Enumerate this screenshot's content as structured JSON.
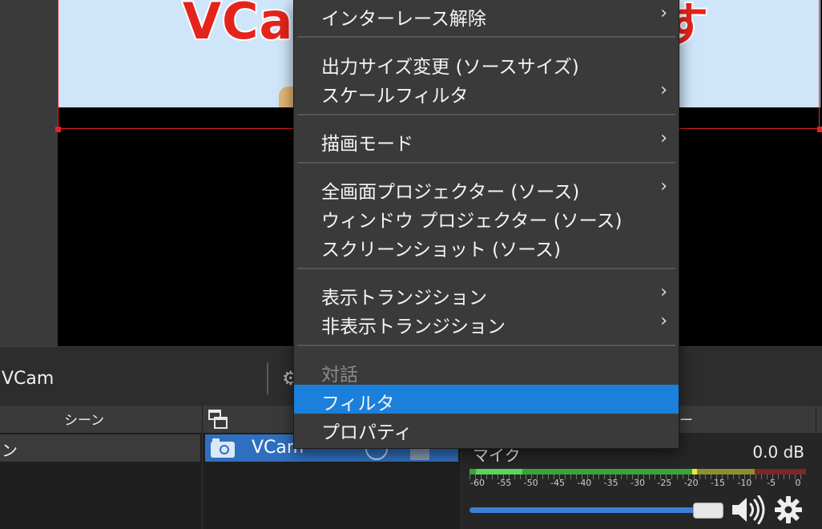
{
  "preview": {
    "banner_text_left": "VCa",
    "banner_text_right": "す"
  },
  "toolbar": {
    "source_name": "VCam"
  },
  "scenes": {
    "header": "シーン",
    "items": [
      {
        "label": "ン"
      }
    ]
  },
  "sources": {
    "items": [
      {
        "label": "VCam",
        "selected": true
      }
    ]
  },
  "mixer": {
    "header": "ー",
    "track_name": "マイク",
    "level": "0.0 dB",
    "meter_ticks": [
      "-60",
      "-55",
      "-50",
      "-45",
      "-40",
      "-35",
      "-30",
      "-25",
      "-20",
      "-15",
      "-10",
      "-5",
      "0"
    ],
    "volume_fraction": 1.0
  },
  "context_menu": {
    "items": [
      {
        "label": "インターレース解除",
        "submenu": true
      },
      {
        "label": "出力サイズ変更 (ソースサイズ)",
        "submenu": false
      },
      {
        "label": "スケールフィルタ",
        "submenu": true
      },
      {
        "label": "描画モード",
        "submenu": true
      },
      {
        "label": "全画面プロジェクター (ソース)",
        "submenu": true
      },
      {
        "label": "ウィンドウ プロジェクター (ソース)",
        "submenu": false
      },
      {
        "label": "スクリーンショット (ソース)",
        "submenu": false
      },
      {
        "label": "表示トランジション",
        "submenu": true
      },
      {
        "label": "非表示トランジション",
        "submenu": true
      },
      {
        "label": "対話",
        "submenu": false,
        "disabled": true
      },
      {
        "label": "フィルタ",
        "submenu": false,
        "highlighted": true
      },
      {
        "label": "プロパティ",
        "submenu": false
      }
    ],
    "arrow_glyph": "›"
  },
  "colors": {
    "accent": "#1b7fdc",
    "selection": "#2f6fbf",
    "source_outline": "#e52222",
    "banner_text": "#e4241c"
  }
}
